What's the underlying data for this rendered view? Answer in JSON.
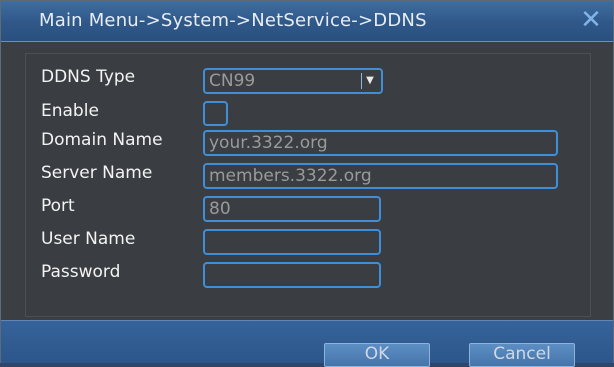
{
  "window": {
    "title": "Main Menu->System->NetService->DDNS",
    "close_icon": "close-icon"
  },
  "form": {
    "ddns_type": {
      "label": "DDNS Type",
      "value": "CN99"
    },
    "enable": {
      "label": "Enable",
      "checked": false
    },
    "domain_name": {
      "label": "Domain Name",
      "value": "your.3322.org"
    },
    "server_name": {
      "label": "Server Name",
      "value": "members.3322.org"
    },
    "port": {
      "label": "Port",
      "value": "80"
    },
    "user_name": {
      "label": "User Name",
      "value": ""
    },
    "password": {
      "label": "Password",
      "value": ""
    }
  },
  "footer": {
    "ok_label": "OK",
    "cancel_label": "Cancel"
  },
  "colors": {
    "accent_blue": "#3f8fd8",
    "title_bar": "#2f5889",
    "panel_bg": "#3a3d41"
  }
}
